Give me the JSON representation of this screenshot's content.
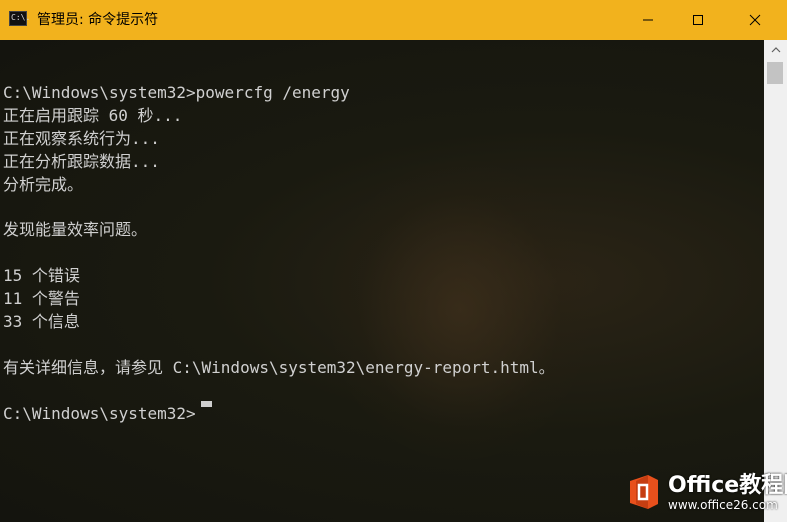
{
  "window": {
    "title": "管理员: 命令提示符",
    "app_icon_text": "C:\\.",
    "icons": {
      "app": "cmd-icon",
      "minimize": "minimize-icon",
      "maximize": "maximize-icon",
      "close": "close-icon"
    },
    "colors": {
      "titlebar": "#f2b21d",
      "text": "#d0d0d0"
    }
  },
  "terminal": {
    "lines": [
      "",
      "C:\\Windows\\system32>powercfg /energy",
      "正在启用跟踪 60 秒...",
      "正在观察系统行为...",
      "正在分析跟踪数据...",
      "分析完成。",
      "",
      "发现能量效率问题。",
      "",
      "15 个错误",
      "11 个警告",
      "33 个信息",
      "",
      "有关详细信息，请参见 C:\\Windows\\system32\\energy-report.html。",
      "",
      "C:\\Windows\\system32>"
    ]
  },
  "watermark": {
    "title": "Office教程网",
    "url": "www.office26.com",
    "logo_color": "#e8501c"
  }
}
